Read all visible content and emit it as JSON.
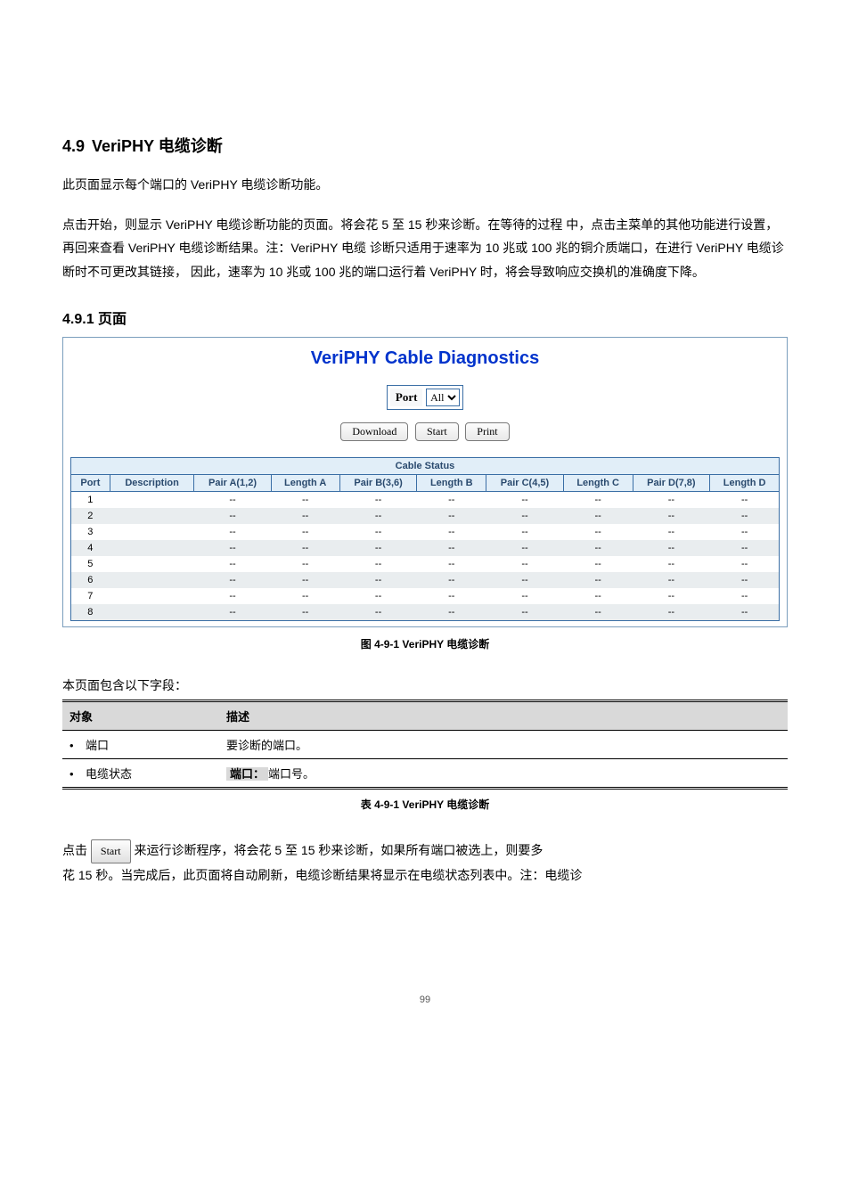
{
  "section": {
    "number": "4.9",
    "title": "VeriPHY 电缆诊断",
    "intro1": "此页面显示每个端口的 VeriPHY 电缆诊断功能。",
    "intro2": "点击开始，则显示 VeriPHY 电缆诊断功能的页面。将会花 5 至 15 秒来诊断。在等待的过程 中，点击主菜单的其他功能进行设置，再回来查看 VeriPHY 电缆诊断结果。注：VeriPHY 电缆 诊断只适用于速率为 10 兆或 100 兆的铜介质端口，在进行 VeriPHY 电缆诊断时不可更改其链接， 因此，速率为 10 兆或 100 兆的端口运行着 VeriPHY 时，将会导致响应交换机的准确度下降。"
  },
  "subsection_title": "4.9.1 页面",
  "panel": {
    "title": "VeriPHY Cable Diagnostics",
    "port_label": "Port",
    "port_selected": "All",
    "buttons": {
      "download": "Download",
      "start": "Start",
      "print": "Print"
    },
    "table_title": "Cable Status",
    "columns": [
      "Port",
      "Description",
      "Pair A(1,2)",
      "Length A",
      "Pair B(3,6)",
      "Length B",
      "Pair C(4,5)",
      "Length C",
      "Pair D(7,8)",
      "Length D"
    ],
    "rows": [
      {
        "port": "1",
        "description": "",
        "pairA": "--",
        "lenA": "--",
        "pairB": "--",
        "lenB": "--",
        "pairC": "--",
        "lenC": "--",
        "pairD": "--",
        "lenD": "--"
      },
      {
        "port": "2",
        "description": "",
        "pairA": "--",
        "lenA": "--",
        "pairB": "--",
        "lenB": "--",
        "pairC": "--",
        "lenC": "--",
        "pairD": "--",
        "lenD": "--"
      },
      {
        "port": "3",
        "description": "",
        "pairA": "--",
        "lenA": "--",
        "pairB": "--",
        "lenB": "--",
        "pairC": "--",
        "lenC": "--",
        "pairD": "--",
        "lenD": "--"
      },
      {
        "port": "4",
        "description": "",
        "pairA": "--",
        "lenA": "--",
        "pairB": "--",
        "lenB": "--",
        "pairC": "--",
        "lenC": "--",
        "pairD": "--",
        "lenD": "--"
      },
      {
        "port": "5",
        "description": "",
        "pairA": "--",
        "lenA": "--",
        "pairB": "--",
        "lenB": "--",
        "pairC": "--",
        "lenC": "--",
        "pairD": "--",
        "lenD": "--"
      },
      {
        "port": "6",
        "description": "",
        "pairA": "--",
        "lenA": "--",
        "pairB": "--",
        "lenB": "--",
        "pairC": "--",
        "lenC": "--",
        "pairD": "--",
        "lenD": "--"
      },
      {
        "port": "7",
        "description": "",
        "pairA": "--",
        "lenA": "--",
        "pairB": "--",
        "lenB": "--",
        "pairC": "--",
        "lenC": "--",
        "pairD": "--",
        "lenD": "--"
      },
      {
        "port": "8",
        "description": "",
        "pairA": "--",
        "lenA": "--",
        "pairB": "--",
        "lenB": "--",
        "pairC": "--",
        "lenC": "--",
        "pairD": "--",
        "lenD": "--"
      }
    ]
  },
  "fig_caption": "图 4-9-1 VeriPHY 电缆诊断",
  "desc_line": "本页面包含以下字段：",
  "obj_table": {
    "head_obj": "对象",
    "head_desc": "描述",
    "rows": [
      {
        "obj": "端口",
        "desc": "要诊断的端口。"
      },
      {
        "obj": "电缆状态",
        "desc_prefix": "端口：",
        "desc_rest": "端口号。"
      }
    ]
  },
  "tbl_caption": "表 4-9-1 VeriPHY 电缆诊断",
  "below": {
    "line1_before": "点击",
    "line1_btn": "Start",
    "line1_after": "来运行诊断程序，将会花 5 至 15 秒来诊断，如果所有端口被选上，则要多",
    "line2": "花 15 秒。当完成后，此页面将自动刷新，电缆诊断结果将显示在电缆状态列表中。注：电缆诊"
  },
  "footer": "99"
}
